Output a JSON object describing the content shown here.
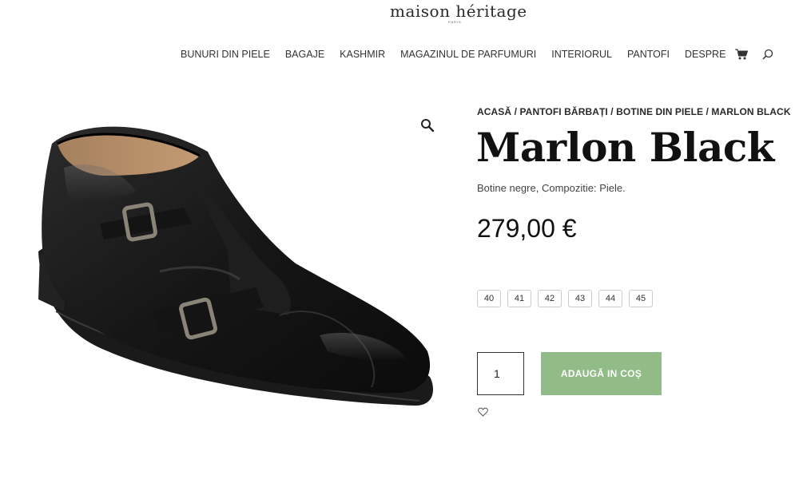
{
  "brand": {
    "logo_text": "maison héritage",
    "logo_sub": "PARIS"
  },
  "nav": {
    "items": [
      {
        "label": "BUNURI DIN PIELE"
      },
      {
        "label": "BAGAJE"
      },
      {
        "label": "KASHMIR"
      },
      {
        "label": "MAGAZINUL DE PARFUMURI"
      },
      {
        "label": "INTERIORUL"
      },
      {
        "label": "PANTOFI"
      },
      {
        "label": "DESPRE"
      }
    ],
    "cart_icon": "cart-icon",
    "search_icon": "search-icon"
  },
  "product": {
    "breadcrumb": "ACASĂ / PANTOFI BĂRBAȚI / BOTINE DIN PIELE / MARLON BLACK",
    "title": "Marlon Black",
    "short_description": "Botine negre, Compozitie: Piele.",
    "price": "279,00 €",
    "sizes": [
      "40",
      "41",
      "42",
      "43",
      "44",
      "45"
    ],
    "quantity": "1",
    "add_to_cart_label": "ADAUGĂ IN COȘ",
    "zoom_icon": "magnifier-icon",
    "wishlist_icon": "heart-icon"
  },
  "colors": {
    "accent_button": "#91bb87",
    "text_dark": "#111111"
  }
}
